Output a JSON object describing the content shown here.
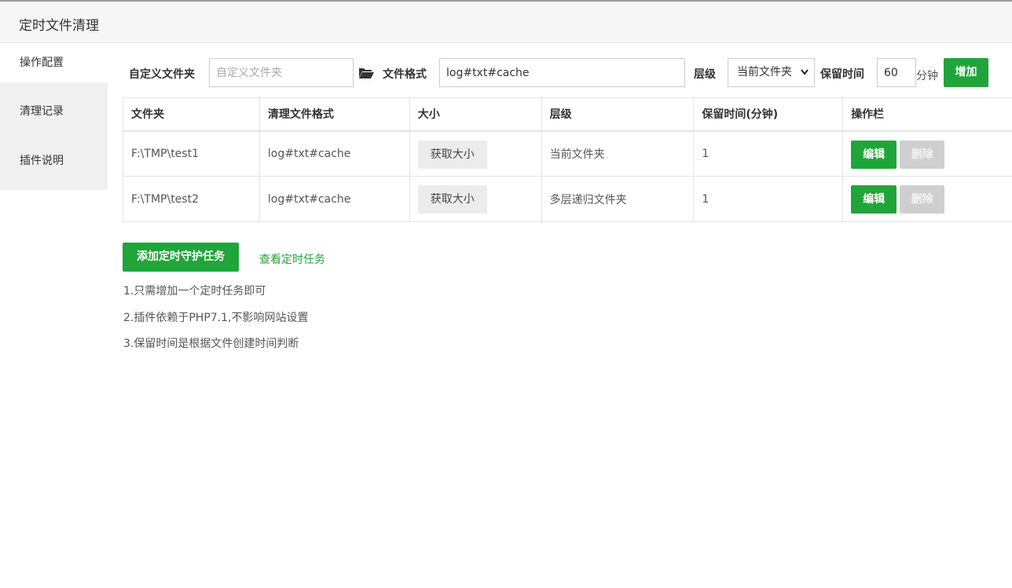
{
  "window": {
    "title": "定时文件清理"
  },
  "sidebar": {
    "items": [
      {
        "label": "操作配置",
        "active": true
      },
      {
        "label": "清理记录",
        "active": false
      },
      {
        "label": "插件说明",
        "active": false
      }
    ]
  },
  "form": {
    "folder_label": "自定义文件夹",
    "folder_placeholder": "自定义文件夹",
    "folder_value": "",
    "format_label": "文件格式",
    "format_value": "log#txt#cache",
    "level_label": "层级",
    "level_selected": "当前文件夹",
    "retention_label": "保留时间",
    "retention_value": "60",
    "retention_unit": "分钟",
    "add_button": "增加"
  },
  "table": {
    "headers": [
      "文件夹",
      "清理文件格式",
      "大小",
      "层级",
      "保留时间(分钟)",
      "操作栏"
    ],
    "rows": [
      {
        "folder": "F:\\TMP\\test1",
        "format": "log#txt#cache",
        "size_button": "获取大小",
        "level": "当前文件夹",
        "retention": "1",
        "edit": "编辑",
        "delete": "删除"
      },
      {
        "folder": "F:\\TMP\\test2",
        "format": "log#txt#cache",
        "size_button": "获取大小",
        "level": "多层递归文件夹",
        "retention": "1",
        "edit": "编辑",
        "delete": "删除"
      }
    ]
  },
  "actions": {
    "add_task_button": "添加定时守护任务",
    "view_task_link": "查看定时任务"
  },
  "notes": [
    "1.只需增加一个定时任务即可",
    "2.插件依赖于PHP7.1,不影响网站设置",
    "3.保留时间是根据文件创建时间判断"
  ],
  "colors": {
    "accent": "#20a53a",
    "disabled": "#cfcfcf",
    "sidebar_bg": "#f0f0f0",
    "title_bg": "#f6f6f6"
  },
  "icons": {
    "folder": "folder-open-icon",
    "select_arrow": "chevron-down-icon"
  }
}
